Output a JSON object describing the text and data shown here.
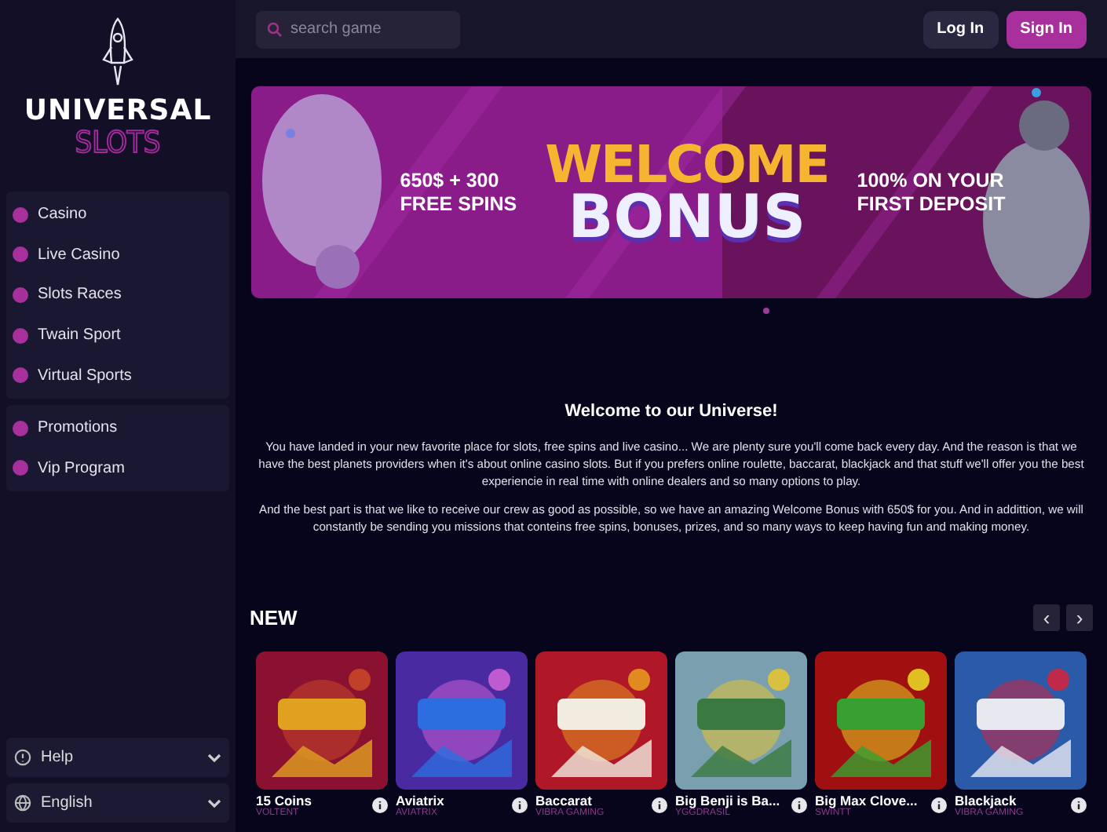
{
  "logo": {
    "title": "UNIVERSAL",
    "subtitle": "SLOTS"
  },
  "sidebar": {
    "groups": [
      {
        "items": [
          {
            "label": "Casino"
          },
          {
            "label": "Live Casino"
          },
          {
            "label": "Slots Races"
          },
          {
            "label": "Twain Sport"
          },
          {
            "label": "Virtual Sports"
          }
        ]
      },
      {
        "items": [
          {
            "label": "Promotions"
          },
          {
            "label": "Vip Program"
          }
        ]
      }
    ],
    "footer": [
      {
        "kind": "help",
        "label": "Help"
      },
      {
        "kind": "language",
        "label": "English"
      }
    ]
  },
  "search": {
    "placeholder": "search game"
  },
  "buttons": [
    {
      "kind": "ghost",
      "label": "Log In"
    },
    {
      "kind": "primary",
      "label": "Sign In"
    }
  ],
  "banner": {
    "left": [
      "650$ + 300",
      "FREE SPINS"
    ],
    "title": "WELCOME",
    "subtitle": "BONUS",
    "right": [
      "100% ON YOUR",
      "FIRST DEPOSIT"
    ]
  },
  "intro": {
    "heading": "Welcome to our Universe!",
    "paragraphs": [
      "You have landed in your new favorite place for slots, free spins and live casino... We are plenty sure you'll come back every day. And the reason is that we have the best planets providers when it's about online casino slots. But if you prefers online roulette, baccarat, blackjack and that stuff we'll offer you the best experiencie in real time with online dealers and so many options to play.",
      "And the best part is that we like to receive our crew as good as possible, so we have an amazing Welcome Bonus with 650$ for you. And in addittion, we will constantly be sending you missions that conteins free spins, bonuses, prizes, and so many ways to keep having fun and making money."
    ]
  },
  "section": {
    "title": "NEW",
    "prev": "‹",
    "next": "›"
  },
  "games": [
    {
      "name": "15 Coins",
      "provider": "VOLTENT"
    },
    {
      "name": "Aviatrix",
      "provider": "AVIATRIX"
    },
    {
      "name": "Baccarat",
      "provider": "VIBRA GAMING"
    },
    {
      "name": "Big Benji is Ba...",
      "provider": "YGGDRASIL"
    },
    {
      "name": "Big Max Clove...",
      "provider": "SWINTT"
    },
    {
      "name": "Blackjack",
      "provider": "VIBRA GAMING"
    }
  ]
}
